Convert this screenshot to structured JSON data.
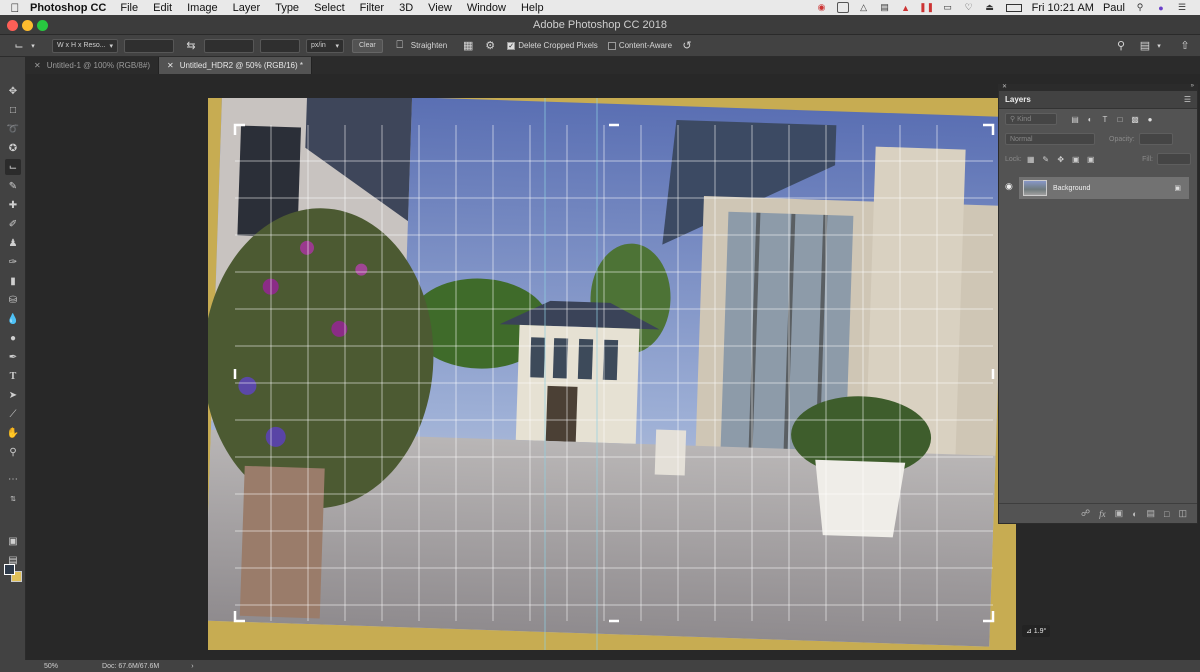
{
  "menubar": {
    "app_name": "Photoshop CC",
    "items": [
      "File",
      "Edit",
      "Image",
      "Layer",
      "Type",
      "Select",
      "Filter",
      "3D",
      "View",
      "Window",
      "Help"
    ],
    "clock": "Fri 10:21 AM",
    "user": "Paul"
  },
  "window": {
    "title": "Adobe Photoshop CC 2018"
  },
  "options": {
    "ratio_preset": "W x H x Reso...",
    "units": "px/in",
    "clear_label": "Clear",
    "straighten_label": "Straighten",
    "delete_cropped_label": "Delete Cropped Pixels",
    "delete_cropped_checked": true,
    "content_aware_label": "Content-Aware",
    "content_aware_checked": false
  },
  "tabs": [
    {
      "label": "Untitled-1 @ 100% (RGB/8#)",
      "active": false
    },
    {
      "label": "Untitled_HDR2 @ 50% (RGB/16) *",
      "active": true
    }
  ],
  "layers_panel": {
    "title": "Layers",
    "filter_placeholder": "Kind",
    "blend_mode": "Normal",
    "opacity_label": "Opacity:",
    "lock_label": "Lock:",
    "fill_label": "Fill:",
    "layers": [
      {
        "name": "Background",
        "locked": true,
        "visible": true
      }
    ]
  },
  "status": {
    "zoom": "50%",
    "doc": "Doc: 67.6M/67.6M"
  },
  "angle_readout": "⊿ 1.9°",
  "colors": {
    "foreground": "#2e3a4a",
    "background": "#e1c15a",
    "transparent_fill": "#c7ac52"
  }
}
